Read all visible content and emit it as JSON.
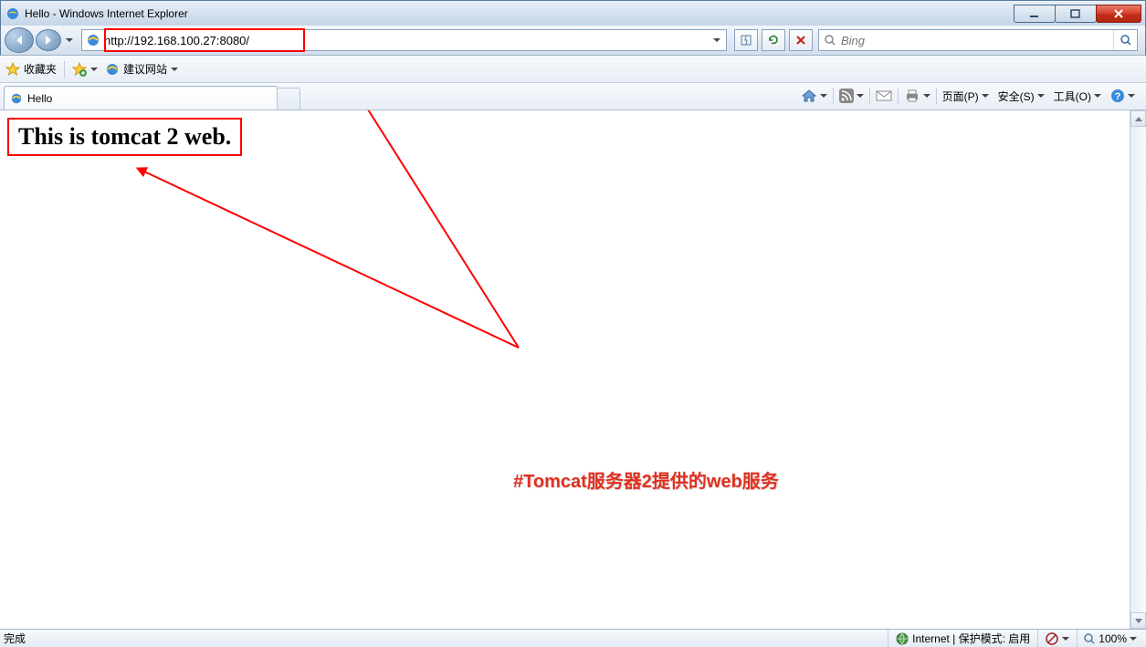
{
  "window": {
    "title": "Hello - Windows Internet Explorer"
  },
  "nav": {
    "url_display": "http://192.168.100.27:8080/",
    "search_placeholder": "Bing"
  },
  "favorites": {
    "label": "收藏夹",
    "suggested_label": "建议网站"
  },
  "tab": {
    "title": "Hello"
  },
  "commandbar": {
    "page": "页面(P)",
    "safety": "安全(S)",
    "tools": "工具(O)"
  },
  "page": {
    "heading": "This is tomcat 2 web.",
    "annotation": "#Tomcat服务器2提供的web服务"
  },
  "status": {
    "left": "完成",
    "zone": "Internet | 保护模式: 启用",
    "zoom": "100%"
  }
}
